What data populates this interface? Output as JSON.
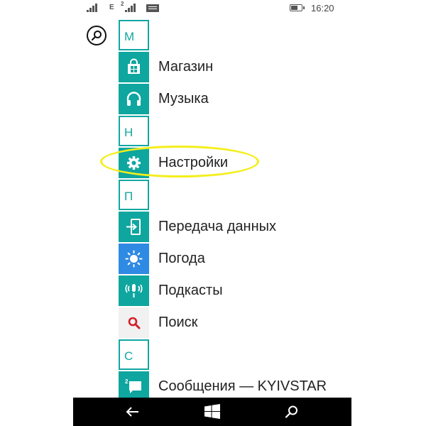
{
  "status_bar": {
    "sim1_network": "E",
    "sim2_number": "2",
    "time": "16:20"
  },
  "apps": [
    {
      "type": "letter",
      "label": "М"
    },
    {
      "type": "app",
      "name": "Магазин",
      "icon": "store-icon"
    },
    {
      "type": "app",
      "name": "Музыка",
      "icon": "headphones-icon"
    },
    {
      "type": "letter",
      "label": "Н"
    },
    {
      "type": "app",
      "name": "Настройки",
      "icon": "gear-icon"
    },
    {
      "type": "letter",
      "label": "П"
    },
    {
      "type": "app",
      "name": "Передача данных",
      "icon": "transfer-icon"
    },
    {
      "type": "app",
      "name": "Погода",
      "icon": "sun-icon"
    },
    {
      "type": "app",
      "name": "Подкасты",
      "icon": "microphone-icon"
    },
    {
      "type": "app",
      "name": "Поиск",
      "icon": "search-icon"
    },
    {
      "type": "letter",
      "label": "С"
    },
    {
      "type": "app",
      "name": "Сообщения — KYIVSTAR",
      "icon": "message-icon"
    }
  ],
  "highlighted_app": "Настройки",
  "colors": {
    "accent": "#0ea69f",
    "weather": "#2f8ae3",
    "highlight": "#f4ee1a",
    "nav_bar": "#000000"
  },
  "nav": {
    "back_icon": "back-arrow-icon",
    "start_icon": "windows-logo-icon",
    "search_icon": "search-icon"
  }
}
